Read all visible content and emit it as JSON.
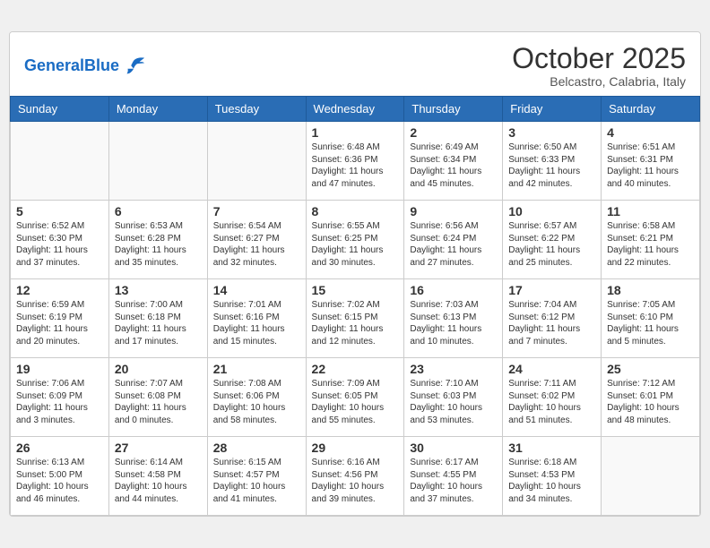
{
  "header": {
    "logo_general": "General",
    "logo_blue": "Blue",
    "month": "October 2025",
    "location": "Belcastro, Calabria, Italy"
  },
  "weekdays": [
    "Sunday",
    "Monday",
    "Tuesday",
    "Wednesday",
    "Thursday",
    "Friday",
    "Saturday"
  ],
  "weeks": [
    [
      {
        "day": "",
        "info": ""
      },
      {
        "day": "",
        "info": ""
      },
      {
        "day": "",
        "info": ""
      },
      {
        "day": "1",
        "info": "Sunrise: 6:48 AM\nSunset: 6:36 PM\nDaylight: 11 hours\nand 47 minutes."
      },
      {
        "day": "2",
        "info": "Sunrise: 6:49 AM\nSunset: 6:34 PM\nDaylight: 11 hours\nand 45 minutes."
      },
      {
        "day": "3",
        "info": "Sunrise: 6:50 AM\nSunset: 6:33 PM\nDaylight: 11 hours\nand 42 minutes."
      },
      {
        "day": "4",
        "info": "Sunrise: 6:51 AM\nSunset: 6:31 PM\nDaylight: 11 hours\nand 40 minutes."
      }
    ],
    [
      {
        "day": "5",
        "info": "Sunrise: 6:52 AM\nSunset: 6:30 PM\nDaylight: 11 hours\nand 37 minutes."
      },
      {
        "day": "6",
        "info": "Sunrise: 6:53 AM\nSunset: 6:28 PM\nDaylight: 11 hours\nand 35 minutes."
      },
      {
        "day": "7",
        "info": "Sunrise: 6:54 AM\nSunset: 6:27 PM\nDaylight: 11 hours\nand 32 minutes."
      },
      {
        "day": "8",
        "info": "Sunrise: 6:55 AM\nSunset: 6:25 PM\nDaylight: 11 hours\nand 30 minutes."
      },
      {
        "day": "9",
        "info": "Sunrise: 6:56 AM\nSunset: 6:24 PM\nDaylight: 11 hours\nand 27 minutes."
      },
      {
        "day": "10",
        "info": "Sunrise: 6:57 AM\nSunset: 6:22 PM\nDaylight: 11 hours\nand 25 minutes."
      },
      {
        "day": "11",
        "info": "Sunrise: 6:58 AM\nSunset: 6:21 PM\nDaylight: 11 hours\nand 22 minutes."
      }
    ],
    [
      {
        "day": "12",
        "info": "Sunrise: 6:59 AM\nSunset: 6:19 PM\nDaylight: 11 hours\nand 20 minutes."
      },
      {
        "day": "13",
        "info": "Sunrise: 7:00 AM\nSunset: 6:18 PM\nDaylight: 11 hours\nand 17 minutes."
      },
      {
        "day": "14",
        "info": "Sunrise: 7:01 AM\nSunset: 6:16 PM\nDaylight: 11 hours\nand 15 minutes."
      },
      {
        "day": "15",
        "info": "Sunrise: 7:02 AM\nSunset: 6:15 PM\nDaylight: 11 hours\nand 12 minutes."
      },
      {
        "day": "16",
        "info": "Sunrise: 7:03 AM\nSunset: 6:13 PM\nDaylight: 11 hours\nand 10 minutes."
      },
      {
        "day": "17",
        "info": "Sunrise: 7:04 AM\nSunset: 6:12 PM\nDaylight: 11 hours\nand 7 minutes."
      },
      {
        "day": "18",
        "info": "Sunrise: 7:05 AM\nSunset: 6:10 PM\nDaylight: 11 hours\nand 5 minutes."
      }
    ],
    [
      {
        "day": "19",
        "info": "Sunrise: 7:06 AM\nSunset: 6:09 PM\nDaylight: 11 hours\nand 3 minutes."
      },
      {
        "day": "20",
        "info": "Sunrise: 7:07 AM\nSunset: 6:08 PM\nDaylight: 11 hours\nand 0 minutes."
      },
      {
        "day": "21",
        "info": "Sunrise: 7:08 AM\nSunset: 6:06 PM\nDaylight: 10 hours\nand 58 minutes."
      },
      {
        "day": "22",
        "info": "Sunrise: 7:09 AM\nSunset: 6:05 PM\nDaylight: 10 hours\nand 55 minutes."
      },
      {
        "day": "23",
        "info": "Sunrise: 7:10 AM\nSunset: 6:03 PM\nDaylight: 10 hours\nand 53 minutes."
      },
      {
        "day": "24",
        "info": "Sunrise: 7:11 AM\nSunset: 6:02 PM\nDaylight: 10 hours\nand 51 minutes."
      },
      {
        "day": "25",
        "info": "Sunrise: 7:12 AM\nSunset: 6:01 PM\nDaylight: 10 hours\nand 48 minutes."
      }
    ],
    [
      {
        "day": "26",
        "info": "Sunrise: 6:13 AM\nSunset: 5:00 PM\nDaylight: 10 hours\nand 46 minutes."
      },
      {
        "day": "27",
        "info": "Sunrise: 6:14 AM\nSunset: 4:58 PM\nDaylight: 10 hours\nand 44 minutes."
      },
      {
        "day": "28",
        "info": "Sunrise: 6:15 AM\nSunset: 4:57 PM\nDaylight: 10 hours\nand 41 minutes."
      },
      {
        "day": "29",
        "info": "Sunrise: 6:16 AM\nSunset: 4:56 PM\nDaylight: 10 hours\nand 39 minutes."
      },
      {
        "day": "30",
        "info": "Sunrise: 6:17 AM\nSunset: 4:55 PM\nDaylight: 10 hours\nand 37 minutes."
      },
      {
        "day": "31",
        "info": "Sunrise: 6:18 AM\nSunset: 4:53 PM\nDaylight: 10 hours\nand 34 minutes."
      },
      {
        "day": "",
        "info": ""
      }
    ]
  ]
}
